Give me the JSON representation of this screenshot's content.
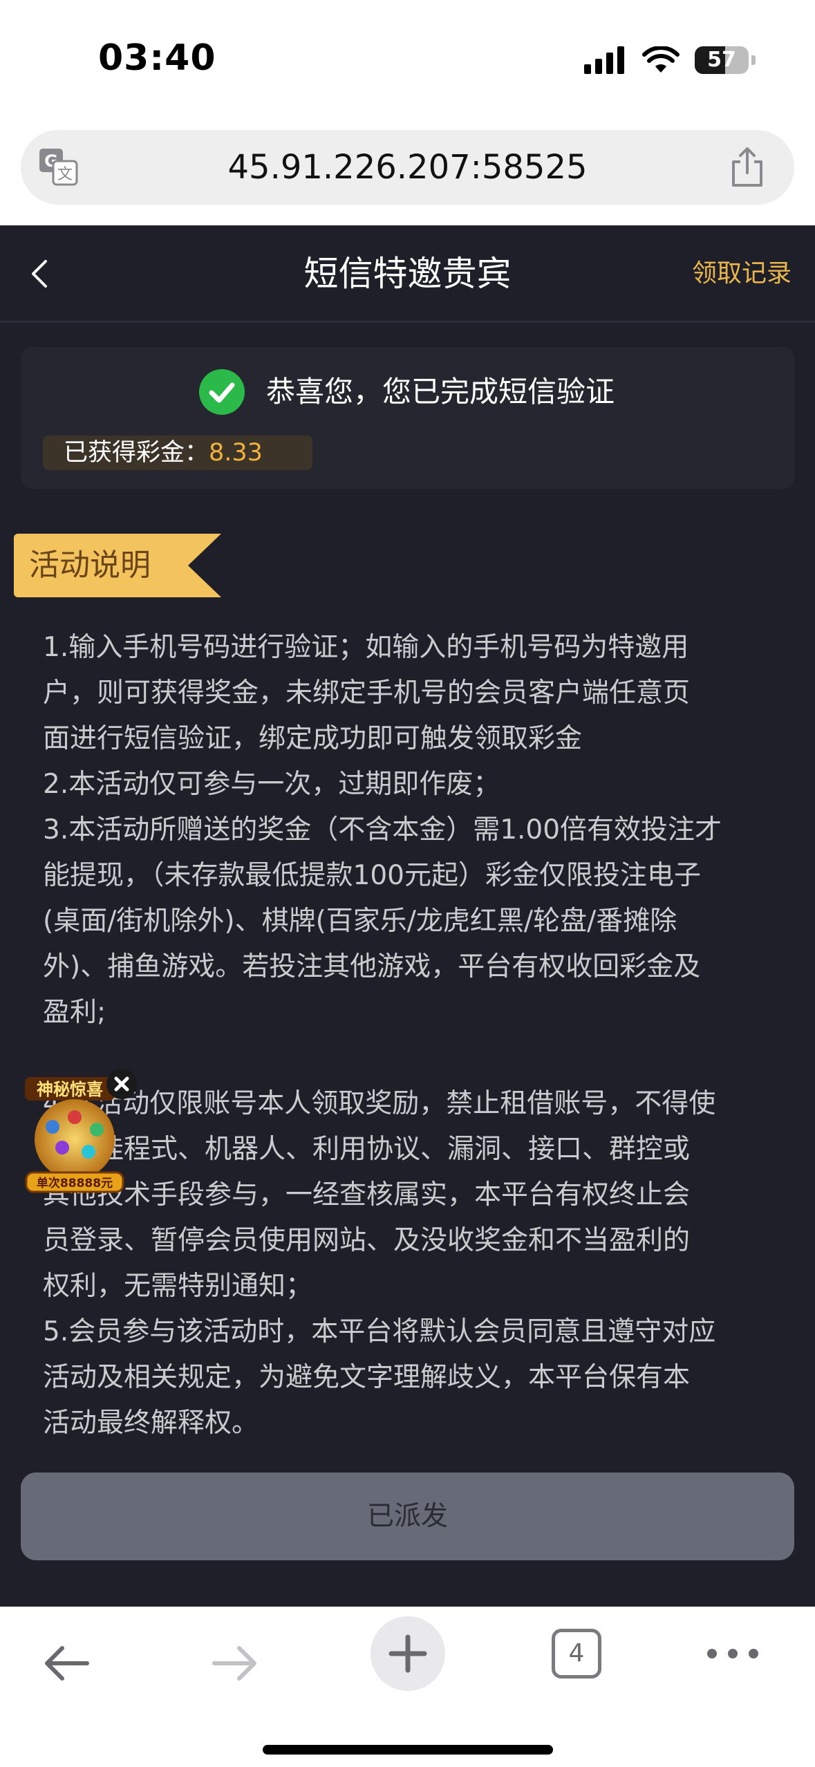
{
  "status_bar": {
    "time": "03:40",
    "battery_percent": 57,
    "battery_label": "57",
    "icons": [
      "cellular-signal-icon",
      "wifi-icon",
      "battery-icon"
    ]
  },
  "browser": {
    "url": "45.91.226.207:58525",
    "icons": [
      "translate-icon",
      "share-icon"
    ],
    "tab_count": "4",
    "bottom_icons": [
      "back-arrow-icon",
      "forward-arrow-icon",
      "plus-icon",
      "tabs-icon",
      "more-icon"
    ]
  },
  "header": {
    "title": "短信特邀贵宾",
    "records_link": "领取记录"
  },
  "verify_card": {
    "message": "恭喜您，您已完成短信验证",
    "bonus_label": "已获得彩金：",
    "bonus_value": "8.33"
  },
  "activity": {
    "ribbon_label": "活动说明",
    "lines": [
      "1.输入手机号码进行验证；如输入的手机号码为特邀用",
      "户，则可获得奖金，未绑定手机号的会员客户端任意页",
      "面进行短信验证，绑定成功即可触发领取彩金",
      "2.本活动仅可参与一次，过期即作废；",
      "3.本活动所赠送的奖金（不含本金）需1.00倍有效投注才",
      "能提现，（未存款最低提款100元起）彩金仅限投注电子",
      "(桌面/街机除外)、棋牌(百家乐/龙虎红黑/轮盘/番摊除",
      "外)、捕鱼游戏。若投注其他游戏，平台有权收回彩金及",
      "盈利;",
      "",
      "4.本活动仅限账号本人领取奖励，禁止租借账号，不得使",
      "用外挂程式、机器人、利用协议、漏洞、接口、群控或",
      "其他技术手段参与，一经查核属实，本平台有权终止会",
      "员登录、暂停会员使用网站、及没收奖金和不当盈利的",
      "权利，无需特别通知；",
      "5.会员参与该活动时，本平台将默认会员同意且遵守对应",
      "活动及相关规定，为避免文字理解歧义，本平台保有本",
      "活动最终解释权。"
    ]
  },
  "float_ad": {
    "title": "神秘惊喜",
    "badge": "单次88888元"
  },
  "action_button": {
    "label": "已派发"
  },
  "colors": {
    "app_bg": "#1e1f28",
    "accent_gold": "#e9b64e",
    "bonus_value": "#f3b23d",
    "ribbon": "#f3c35d",
    "success_green": "#2bb94a",
    "button_disabled": "#666b77"
  }
}
